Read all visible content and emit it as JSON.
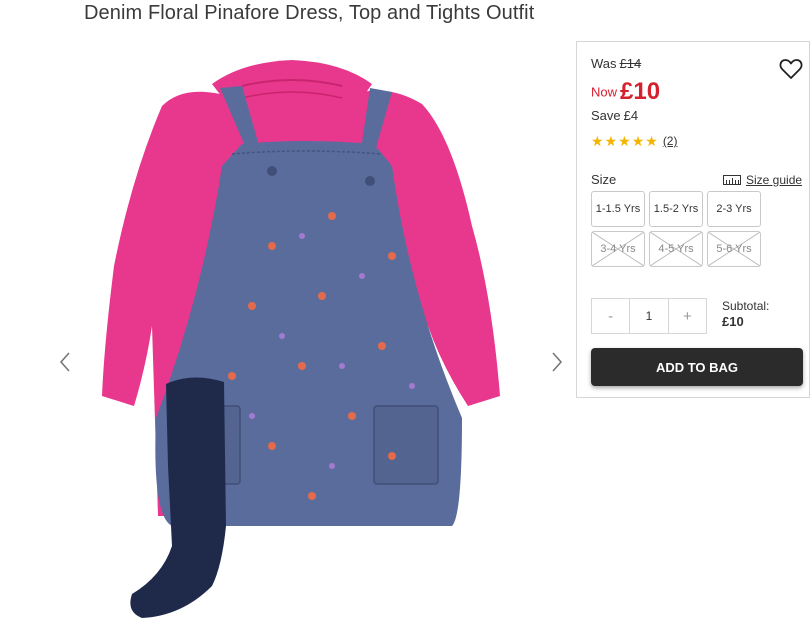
{
  "product": {
    "title": "Denim Floral Pinafore Dress, Top and Tights Outfit"
  },
  "price": {
    "was_label": "Was",
    "was_value": "£14",
    "now_label": "Now",
    "now_value": "£10",
    "save_label": "Save",
    "save_value": "£4"
  },
  "rating": {
    "stars": 5,
    "max_stars": 5,
    "reviews": "(2)"
  },
  "size": {
    "label": "Size",
    "guide": "Size guide",
    "options": [
      {
        "label": "1-1.5 Yrs",
        "available": true
      },
      {
        "label": "1.5-2 Yrs",
        "available": true
      },
      {
        "label": "2-3 Yrs",
        "available": true
      },
      {
        "label": "3-4 Yrs",
        "available": false
      },
      {
        "label": "4-5 Yrs",
        "available": false
      },
      {
        "label": "5-6 Yrs",
        "available": false
      }
    ]
  },
  "quantity": {
    "minus": "-",
    "value": "1",
    "plus": "+"
  },
  "subtotal": {
    "label": "Subtotal:",
    "value": "£10"
  },
  "cart": {
    "add_label": "ADD TO BAG"
  },
  "colors": {
    "price_red": "#d6202e",
    "star_yellow": "#f5b400",
    "button_dark": "#2b2b2b",
    "top_pink": "#e8388e",
    "denim_blue": "#5a6c9c",
    "tights_navy": "#1f2a4a"
  },
  "icons": {
    "heart": "heart-outline-icon",
    "ruler": "ruler-icon",
    "prev": "chevron-left-icon",
    "next": "chevron-right-icon"
  }
}
